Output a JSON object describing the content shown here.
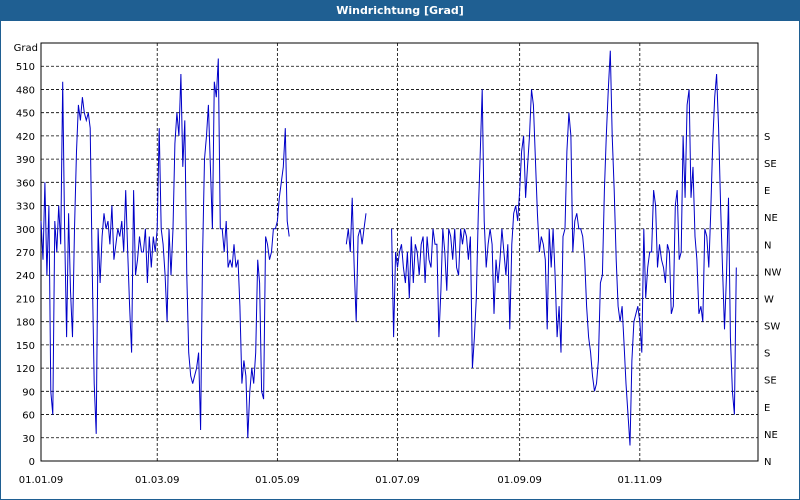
{
  "window": {
    "title": "Windrichtung [Grad]"
  },
  "chart_data": {
    "type": "line",
    "title": "Windrichtung [Grad]",
    "ylabel": "Grad",
    "ylim": [
      0,
      540
    ],
    "yticks": [
      0,
      30,
      60,
      90,
      120,
      150,
      180,
      210,
      240,
      270,
      300,
      330,
      360,
      390,
      420,
      450,
      480,
      510
    ],
    "y2ticks": [
      "N",
      "NE",
      "E",
      "SE",
      "S",
      "SW",
      "W",
      "NW",
      "N",
      "NE",
      "E",
      "SE",
      "S"
    ],
    "xlim": [
      "2009-01-01",
      "2009-12-31"
    ],
    "xticks": [
      {
        "date": "2009-01-01",
        "label": "01.01.09"
      },
      {
        "date": "2009-03-01",
        "label": "01.03.09"
      },
      {
        "date": "2009-05-01",
        "label": "01.05.09"
      },
      {
        "date": "2009-07-01",
        "label": "01.07.09"
      },
      {
        "date": "2009-09-01",
        "label": "01.09.09"
      },
      {
        "date": "2009-11-01",
        "label": "01.11.09"
      }
    ],
    "grid": true,
    "line_color": "#0000c8",
    "segments": [
      {
        "x": [
          "2009-01-01",
          "2009-01-02",
          "2009-01-03",
          "2009-01-04",
          "2009-01-05",
          "2009-01-06",
          "2009-01-07",
          "2009-01-08",
          "2009-01-09",
          "2009-01-10",
          "2009-01-11",
          "2009-01-12",
          "2009-01-13",
          "2009-01-14",
          "2009-01-15",
          "2009-01-16",
          "2009-01-17",
          "2009-01-18",
          "2009-01-19",
          "2009-01-20",
          "2009-01-21",
          "2009-01-22",
          "2009-01-23",
          "2009-01-24",
          "2009-01-25",
          "2009-01-26",
          "2009-01-27",
          "2009-01-28",
          "2009-01-29",
          "2009-01-30",
          "2009-01-31",
          "2009-02-01",
          "2009-02-02",
          "2009-02-03",
          "2009-02-04",
          "2009-02-05",
          "2009-02-06",
          "2009-02-07",
          "2009-02-08",
          "2009-02-09",
          "2009-02-10",
          "2009-02-11",
          "2009-02-12",
          "2009-02-13",
          "2009-02-14",
          "2009-02-15",
          "2009-02-16",
          "2009-02-17",
          "2009-02-18",
          "2009-02-19",
          "2009-02-20",
          "2009-02-21",
          "2009-02-22",
          "2009-02-23",
          "2009-02-24",
          "2009-02-25",
          "2009-02-26",
          "2009-02-27",
          "2009-02-28",
          "2009-03-01",
          "2009-03-02",
          "2009-03-03",
          "2009-03-04",
          "2009-03-05",
          "2009-03-06",
          "2009-03-07",
          "2009-03-08",
          "2009-03-09",
          "2009-03-10",
          "2009-03-11",
          "2009-03-12",
          "2009-03-13",
          "2009-03-14",
          "2009-03-15",
          "2009-03-16",
          "2009-03-17",
          "2009-03-18",
          "2009-03-19",
          "2009-03-20",
          "2009-03-21",
          "2009-03-22",
          "2009-03-23",
          "2009-03-24",
          "2009-03-25",
          "2009-03-26",
          "2009-03-27",
          "2009-03-28",
          "2009-03-29",
          "2009-03-30",
          "2009-03-31",
          "2009-04-01",
          "2009-04-02",
          "2009-04-03",
          "2009-04-04",
          "2009-04-05",
          "2009-04-06",
          "2009-04-07",
          "2009-04-08",
          "2009-04-09",
          "2009-04-10",
          "2009-04-11",
          "2009-04-12",
          "2009-04-13",
          "2009-04-14",
          "2009-04-15",
          "2009-04-16",
          "2009-04-17",
          "2009-04-18",
          "2009-04-19",
          "2009-04-20",
          "2009-04-21",
          "2009-04-22",
          "2009-04-23",
          "2009-04-24",
          "2009-04-25",
          "2009-04-26",
          "2009-04-27",
          "2009-04-28",
          "2009-04-29",
          "2009-04-30",
          "2009-05-01",
          "2009-05-02",
          "2009-05-03",
          "2009-05-04",
          "2009-05-05",
          "2009-05-06",
          "2009-05-07",
          "2009-05-08",
          "2009-05-09",
          "2009-05-10",
          "2009-05-11",
          "2009-05-12",
          "2009-05-13",
          "2009-05-14",
          "2009-05-15",
          "2009-05-16",
          "2009-05-17",
          "2009-05-18",
          "2009-05-19",
          "2009-05-20",
          "2009-05-21",
          "2009-05-22",
          "2009-05-23",
          "2009-05-24",
          "2009-05-25",
          "2009-05-26",
          "2009-05-27",
          "2009-05-28",
          "2009-05-29"
        ],
        "y": [
          310,
          260,
          360,
          240,
          330,
          90,
          60,
          310,
          270,
          330,
          280,
          490,
          300,
          160,
          320,
          220,
          160,
          300,
          400,
          460,
          440,
          470,
          450,
          440,
          450,
          430,
          250,
          100,
          35,
          300,
          230,
          290,
          320,
          300,
          310,
          280,
          330,
          260,
          280,
          300,
          290,
          310,
          270,
          350,
          270,
          200,
          140,
          350,
          240,
          260,
          290,
          270,
          270,
          300,
          230,
          290,
          250,
          290,
          270,
          300,
          430,
          300,
          280,
          240,
          180,
          300,
          240,
          300,
          410,
          450,
          420,
          500,
          380,
          440,
          240,
          140,
          110,
          100,
          110,
          120,
          140,
          40,
          260,
          390,
          420,
          460,
          380,
          300,
          490,
          470,
          520,
          300,
          300,
          270,
          310,
          250,
          260,
          250,
          280,
          250,
          260,
          200,
          100,
          130,
          110,
          30,
          90,
          120,
          100,
          140,
          260,
          230,
          90,
          80,
          290,
          280,
          260,
          270,
          300,
          300,
          310,
          340,
          360,
          380,
          430,
          310,
          290
        ]
      },
      {
        "x": [
          "2009-06-05",
          "2009-06-06",
          "2009-06-07",
          "2009-06-08",
          "2009-06-09",
          "2009-06-10",
          "2009-06-11",
          "2009-06-12",
          "2009-06-13",
          "2009-06-14",
          "2009-06-15"
        ],
        "y": [
          280,
          300,
          270,
          340,
          250,
          180,
          290,
          300,
          280,
          300,
          320
        ]
      },
      {
        "x": [
          "2009-06-28",
          "2009-06-29",
          "2009-06-30",
          "2009-07-01",
          "2009-07-02",
          "2009-07-03",
          "2009-07-04",
          "2009-07-05",
          "2009-07-06",
          "2009-07-07",
          "2009-07-08",
          "2009-07-09",
          "2009-07-10",
          "2009-07-11",
          "2009-07-12",
          "2009-07-13",
          "2009-07-14",
          "2009-07-15",
          "2009-07-16",
          "2009-07-17",
          "2009-07-18",
          "2009-07-19",
          "2009-07-20",
          "2009-07-21",
          "2009-07-22",
          "2009-07-23",
          "2009-07-24",
          "2009-07-25",
          "2009-07-26",
          "2009-07-27",
          "2009-07-28",
          "2009-07-29",
          "2009-07-30",
          "2009-07-31",
          "2009-08-01",
          "2009-08-02",
          "2009-08-03",
          "2009-08-04",
          "2009-08-05",
          "2009-08-06",
          "2009-08-07",
          "2009-08-08",
          "2009-08-09",
          "2009-08-10",
          "2009-08-11",
          "2009-08-12",
          "2009-08-13",
          "2009-08-14",
          "2009-08-15",
          "2009-08-16",
          "2009-08-17",
          "2009-08-18",
          "2009-08-19",
          "2009-08-20",
          "2009-08-21",
          "2009-08-22",
          "2009-08-23",
          "2009-08-24",
          "2009-08-25",
          "2009-08-26",
          "2009-08-27",
          "2009-08-28",
          "2009-08-29",
          "2009-08-30",
          "2009-08-31",
          "2009-09-01",
          "2009-09-02",
          "2009-09-03",
          "2009-09-04",
          "2009-09-05",
          "2009-09-06",
          "2009-09-07",
          "2009-09-08",
          "2009-09-09",
          "2009-09-10",
          "2009-09-11",
          "2009-09-12",
          "2009-09-13",
          "2009-09-14",
          "2009-09-15",
          "2009-09-16",
          "2009-09-17",
          "2009-09-18",
          "2009-09-19",
          "2009-09-20",
          "2009-09-21",
          "2009-09-22",
          "2009-09-23",
          "2009-09-24",
          "2009-09-25",
          "2009-09-26",
          "2009-09-27",
          "2009-09-28",
          "2009-09-29",
          "2009-09-30",
          "2009-10-01",
          "2009-10-02",
          "2009-10-03",
          "2009-10-04",
          "2009-10-05",
          "2009-10-06",
          "2009-10-07",
          "2009-10-08",
          "2009-10-09",
          "2009-10-10",
          "2009-10-11",
          "2009-10-12",
          "2009-10-13",
          "2009-10-14",
          "2009-10-15",
          "2009-10-16",
          "2009-10-17",
          "2009-10-18",
          "2009-10-19",
          "2009-10-20",
          "2009-10-21",
          "2009-10-22",
          "2009-10-23",
          "2009-10-24",
          "2009-10-25",
          "2009-10-26",
          "2009-10-27",
          "2009-10-28",
          "2009-10-29",
          "2009-10-30",
          "2009-10-31",
          "2009-11-01",
          "2009-11-02",
          "2009-11-03",
          "2009-11-04",
          "2009-11-05",
          "2009-11-06",
          "2009-11-07",
          "2009-11-08",
          "2009-11-09",
          "2009-11-10",
          "2009-11-11",
          "2009-11-12",
          "2009-11-13",
          "2009-11-14",
          "2009-11-15",
          "2009-11-16",
          "2009-11-17",
          "2009-11-18",
          "2009-11-19",
          "2009-11-20",
          "2009-11-21",
          "2009-11-22",
          "2009-11-23",
          "2009-11-24",
          "2009-11-25",
          "2009-11-26",
          "2009-11-27",
          "2009-11-28",
          "2009-11-29",
          "2009-11-30",
          "2009-12-01",
          "2009-12-02",
          "2009-12-03",
          "2009-12-04",
          "2009-12-05",
          "2009-12-06",
          "2009-12-07",
          "2009-12-08",
          "2009-12-09",
          "2009-12-10",
          "2009-12-11",
          "2009-12-12",
          "2009-12-13",
          "2009-12-14",
          "2009-12-15",
          "2009-12-16",
          "2009-12-17",
          "2009-12-18",
          "2009-12-19",
          "2009-12-20",
          "2009-12-21",
          "2009-12-22",
          "2009-12-23",
          "2009-12-24",
          "2009-12-25",
          "2009-12-26",
          "2009-12-27"
        ],
        "y": [
          300,
          160,
          270,
          250,
          270,
          280,
          250,
          230,
          270,
          210,
          290,
          230,
          280,
          270,
          240,
          280,
          290,
          230,
          290,
          260,
          250,
          300,
          280,
          280,
          160,
          220,
          300,
          270,
          220,
          300,
          290,
          260,
          300,
          250,
          240,
          300,
          280,
          300,
          290,
          260,
          290,
          120,
          160,
          210,
          320,
          400,
          480,
          310,
          250,
          280,
          300,
          280,
          190,
          260,
          230,
          260,
          300,
          270,
          240,
          280,
          170,
          280,
          320,
          330,
          310,
          350,
          400,
          420,
          340,
          380,
          420,
          480,
          460,
          390,
          320,
          270,
          290,
          280,
          260,
          170,
          300,
          250,
          300,
          240,
          160,
          200,
          140,
          290,
          300,
          400,
          450,
          420,
          270,
          310,
          320,
          300,
          300,
          290,
          260,
          200,
          160,
          140,
          110,
          90,
          100,
          130,
          230,
          240,
          350,
          420,
          480,
          530,
          420,
          350,
          260,
          200,
          180,
          200,
          150,
          100,
          60,
          20,
          130,
          180,
          190,
          200,
          180,
          140,
          300,
          210,
          250,
          270,
          270,
          350,
          330,
          250,
          280,
          260,
          250,
          230,
          280,
          270,
          190,
          200,
          330,
          350,
          260,
          270,
          420,
          340,
          460,
          480,
          340,
          380,
          290,
          260,
          190,
          200,
          180,
          300,
          290,
          250,
          320,
          410,
          470,
          500,
          430,
          330,
          250,
          170,
          240,
          340,
          160,
          90,
          60,
          250
        ]
      }
    ]
  }
}
